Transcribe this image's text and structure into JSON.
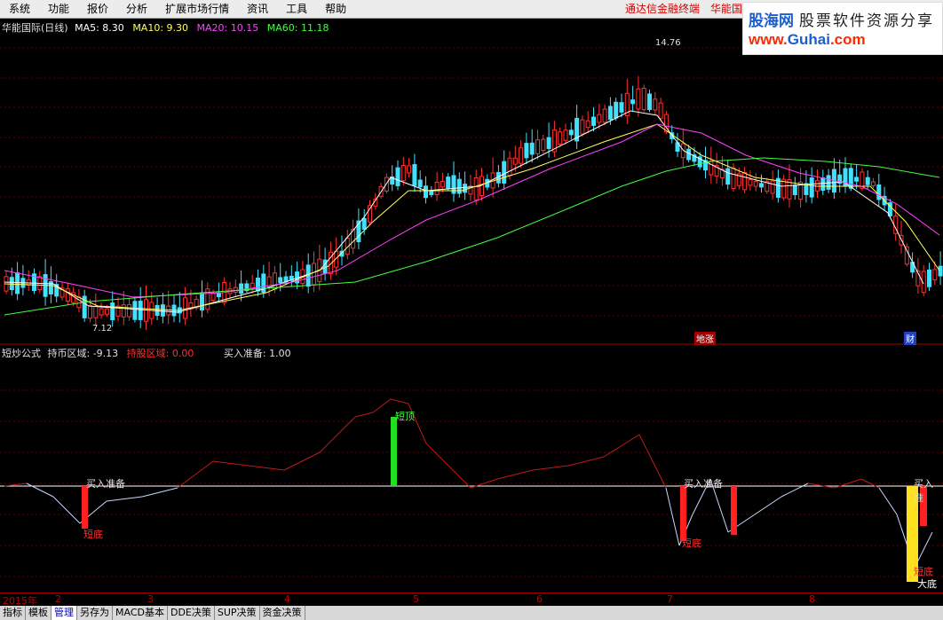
{
  "menu": [
    "系统",
    "功能",
    "报价",
    "分析",
    "扩展市场行情",
    "资讯",
    "工具",
    "帮助"
  ],
  "menu_right": {
    "terminal": "通达信金融终端",
    "stock_short": "华能国"
  },
  "logo": {
    "cn_name": "股海网",
    "slogan": "股票软件资源分享",
    "url_prefix": "www.",
    "url_domain": "Guhai",
    "url_suffix": ".com"
  },
  "price_panel": {
    "stock": "华能国际(日线)",
    "ma5": "MA5: 8.30",
    "ma10": "MA10: 9.30",
    "ma20": "MA20: 10.15",
    "ma60": "MA60: 11.18",
    "high_label": "14.76",
    "low_label": "7.12",
    "tag_a": "地涨",
    "tag_b": "财"
  },
  "indicator_panel": {
    "formula": "短炒公式",
    "market_zone_label": "持币区域: -9.13",
    "hold_zone_label": "持股区域: 0.00",
    "buy_prep_label": "买入准备: 1.00",
    "marks": {
      "buy_prep": "买入准备",
      "buy_prep_right": "买入准",
      "short_top": "短顶",
      "short_bottom": "短底",
      "big_bottom": "大底"
    }
  },
  "axis": {
    "year": "2015年",
    "months": [
      "2",
      "3",
      "4",
      "5",
      "6",
      "7",
      "8"
    ]
  },
  "bottom_tabs": [
    "指标",
    "模板",
    "管理",
    "另存为",
    "MACD基本",
    "DDE决策",
    "SUP决策",
    "资金决策"
  ],
  "active_tab": "管理",
  "colors": {
    "up": "#ff3030",
    "down": "#40e0ff",
    "ma5": "#ffffff",
    "ma10": "#ffff60",
    "ma20": "#ff40ff",
    "ma60": "#40ff40",
    "grid": "#600000"
  }
}
